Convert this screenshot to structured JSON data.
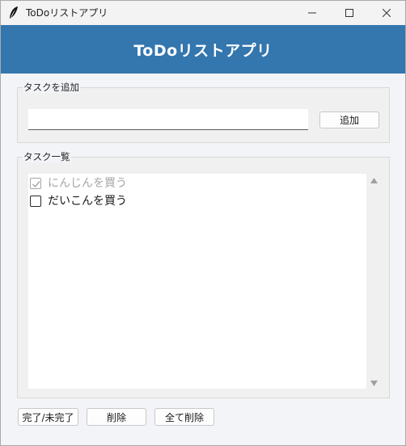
{
  "window": {
    "title": "ToDoリストアプリ",
    "icon": "feather-icon"
  },
  "header": {
    "title": "ToDoリストアプリ",
    "background": "#3476ae"
  },
  "add_section": {
    "label": "タスクを追加",
    "input_value": "",
    "add_button_label": "追加"
  },
  "list_section": {
    "label": "タスク一覧",
    "tasks": [
      {
        "label": "にんじんを買う",
        "done": true
      },
      {
        "label": "だいこんを買う",
        "done": false
      }
    ]
  },
  "actions": {
    "toggle_label": "完了/未完了",
    "delete_label": "削除",
    "delete_all_label": "全て削除"
  }
}
